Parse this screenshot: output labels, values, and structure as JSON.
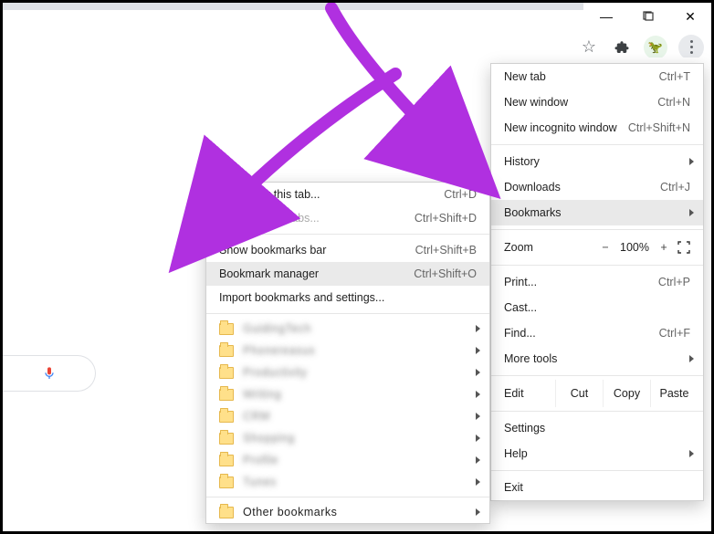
{
  "window": {
    "min": "—",
    "max": "▢",
    "close": "✕"
  },
  "toolbar": {
    "star": "☆",
    "ext": "✦",
    "avatar": "🦖"
  },
  "mainmenu": {
    "newtab": {
      "label": "New tab",
      "sc": "Ctrl+T"
    },
    "newwin": {
      "label": "New window",
      "sc": "Ctrl+N"
    },
    "incog": {
      "label": "New incognito window",
      "sc": "Ctrl+Shift+N"
    },
    "history": {
      "label": "History"
    },
    "downloads": {
      "label": "Downloads",
      "sc": "Ctrl+J"
    },
    "bookmarks": {
      "label": "Bookmarks"
    },
    "zoom": {
      "label": "Zoom",
      "minus": "−",
      "value": "100%",
      "plus": "+"
    },
    "print": {
      "label": "Print...",
      "sc": "Ctrl+P"
    },
    "cast": {
      "label": "Cast..."
    },
    "find": {
      "label": "Find...",
      "sc": "Ctrl+F"
    },
    "tools": {
      "label": "More tools"
    },
    "edit": {
      "label": "Edit",
      "cut": "Cut",
      "copy": "Copy",
      "paste": "Paste"
    },
    "settings": {
      "label": "Settings"
    },
    "help": {
      "label": "Help"
    },
    "exit": {
      "label": "Exit"
    }
  },
  "submenu": {
    "bmthis": {
      "label": "Bookmark this tab...",
      "sc": "Ctrl+D"
    },
    "bmall": {
      "label": "Bookmark all tabs...",
      "sc": "Ctrl+Shift+D"
    },
    "showbar": {
      "label": "Show bookmarks bar",
      "sc": "Ctrl+Shift+B"
    },
    "manager": {
      "label": "Bookmark manager",
      "sc": "Ctrl+Shift+O"
    },
    "import": {
      "label": "Import bookmarks and settings..."
    },
    "folders": [
      "GuidingTech",
      "Phonereasus",
      "Productivity",
      "Writing",
      "CRM",
      "Shopping",
      "Profile",
      "Tunes"
    ],
    "other": "Other bookmarks"
  }
}
